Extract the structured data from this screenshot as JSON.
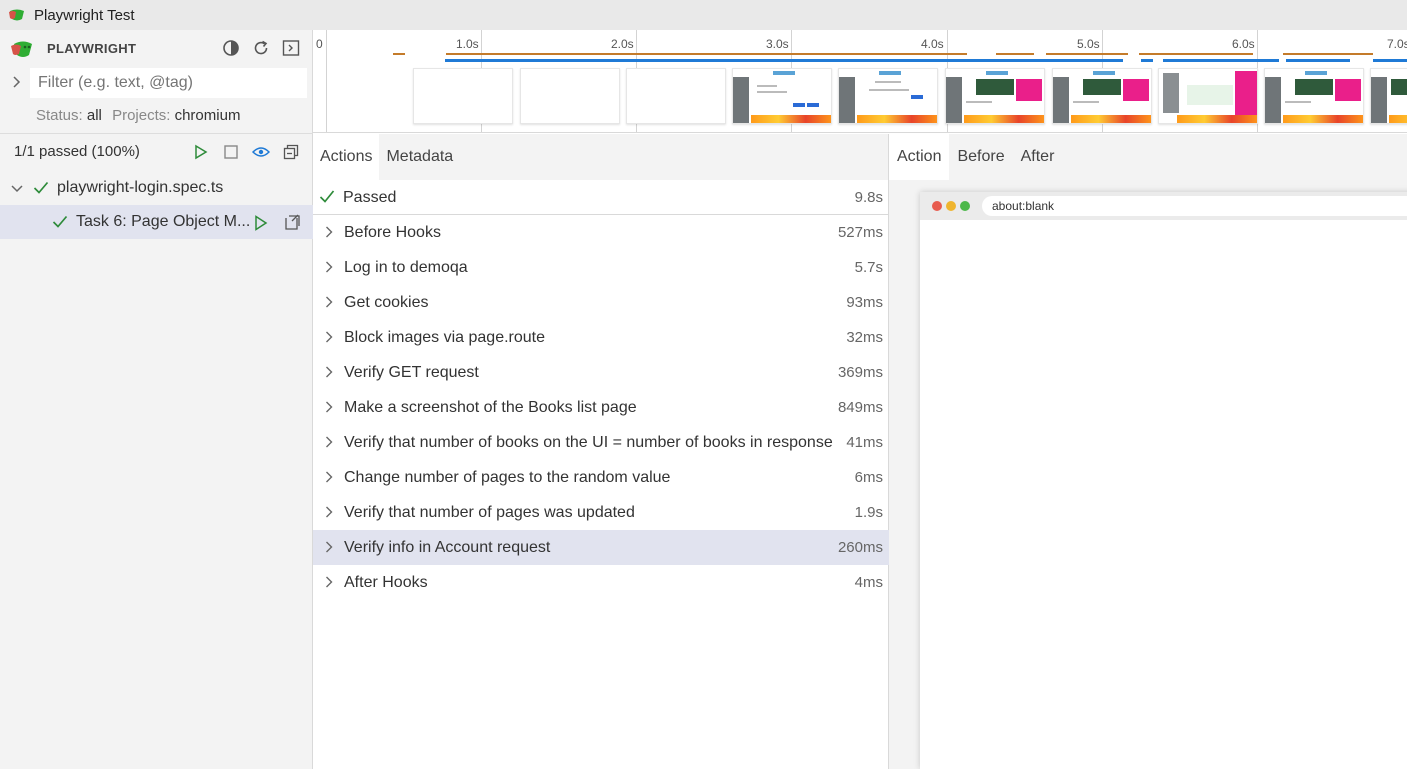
{
  "window": {
    "title": "Playwright Test"
  },
  "sidebar": {
    "brand": "PLAYWRIGHT",
    "filter_placeholder": "Filter (e.g. text, @tag)",
    "status_label": "Status:",
    "status_value": "all",
    "projects_label": "Projects:",
    "projects_value": "chromium",
    "passed_summary": "1/1 passed (100%)",
    "file_name": "playwright-login.spec.ts",
    "test_name": "Task 6: Page Object M..."
  },
  "timeline": {
    "start_label": "0",
    "ticks": [
      "1.0s",
      "2.0s",
      "3.0s",
      "4.0s",
      "5.0s",
      "6.0s",
      "7.0s"
    ]
  },
  "actions_pane": {
    "tabs": [
      "Actions",
      "Metadata"
    ],
    "result_label": "Passed",
    "result_duration": "9.8s",
    "actions": [
      {
        "label": "Before Hooks",
        "duration": "527ms"
      },
      {
        "label": "Log in to demoqa",
        "duration": "5.7s"
      },
      {
        "label": "Get cookies",
        "duration": "93ms"
      },
      {
        "label": "Block images via page.route",
        "duration": "32ms"
      },
      {
        "label": "Verify GET request",
        "duration": "369ms"
      },
      {
        "label": "Make a screenshot of the Books list page",
        "duration": "849ms"
      },
      {
        "label": "Verify that number of books on the UI = number of books in response",
        "duration": "41ms"
      },
      {
        "label": "Change number of pages to the random value",
        "duration": "6ms"
      },
      {
        "label": "Verify that number of pages was updated",
        "duration": "1.9s"
      },
      {
        "label": "Verify info in Account request",
        "duration": "260ms"
      },
      {
        "label": "After Hooks",
        "duration": "4ms"
      }
    ]
  },
  "right_pane": {
    "tabs": [
      "Action",
      "Before",
      "After"
    ],
    "url": "about:blank"
  },
  "colors": {
    "accent_green": "#2e8b3a",
    "selected_row": "#e1e3ef",
    "timeline_orange": "#c47b2a",
    "timeline_blue": "#1f7ad6"
  }
}
